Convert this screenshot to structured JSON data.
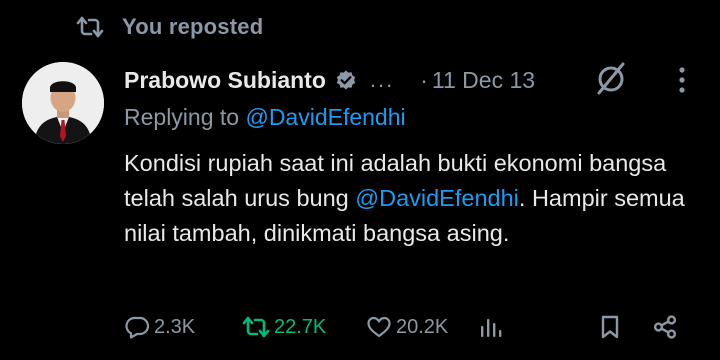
{
  "repost_banner": {
    "label": "You reposted"
  },
  "tweet": {
    "author_name": "Prabowo Subianto",
    "ellipsis": "...",
    "separator": "·",
    "date": "11 Dec 13",
    "replying_prefix": "Replying to ",
    "replying_handle": "@DavidEfendhi",
    "body_part1": "Kondisi rupiah saat ini adalah bukti ekonomi bangsa telah salah urus bung ",
    "body_mention": "@DavidEfendhi",
    "body_part2": ". Hampir semua nilai tambah, dinikmati bangsa asing."
  },
  "actions": {
    "replies": "2.3K",
    "reposts": "22.7K",
    "likes": "20.2K"
  },
  "colors": {
    "background": "#000000",
    "text_primary": "#e7e9ea",
    "text_secondary": "#8b98a5",
    "link": "#1d9bf0",
    "repost_active": "#00ba7c"
  },
  "icons": {
    "repost_banner": "repost-icon",
    "verified": "verified-badge-icon",
    "grok": "grok-icon",
    "more": "more-options-icon",
    "reply": "reply-icon",
    "repost": "repost-icon",
    "like": "like-icon",
    "views": "views-icon",
    "bookmark": "bookmark-icon",
    "share": "share-icon"
  }
}
